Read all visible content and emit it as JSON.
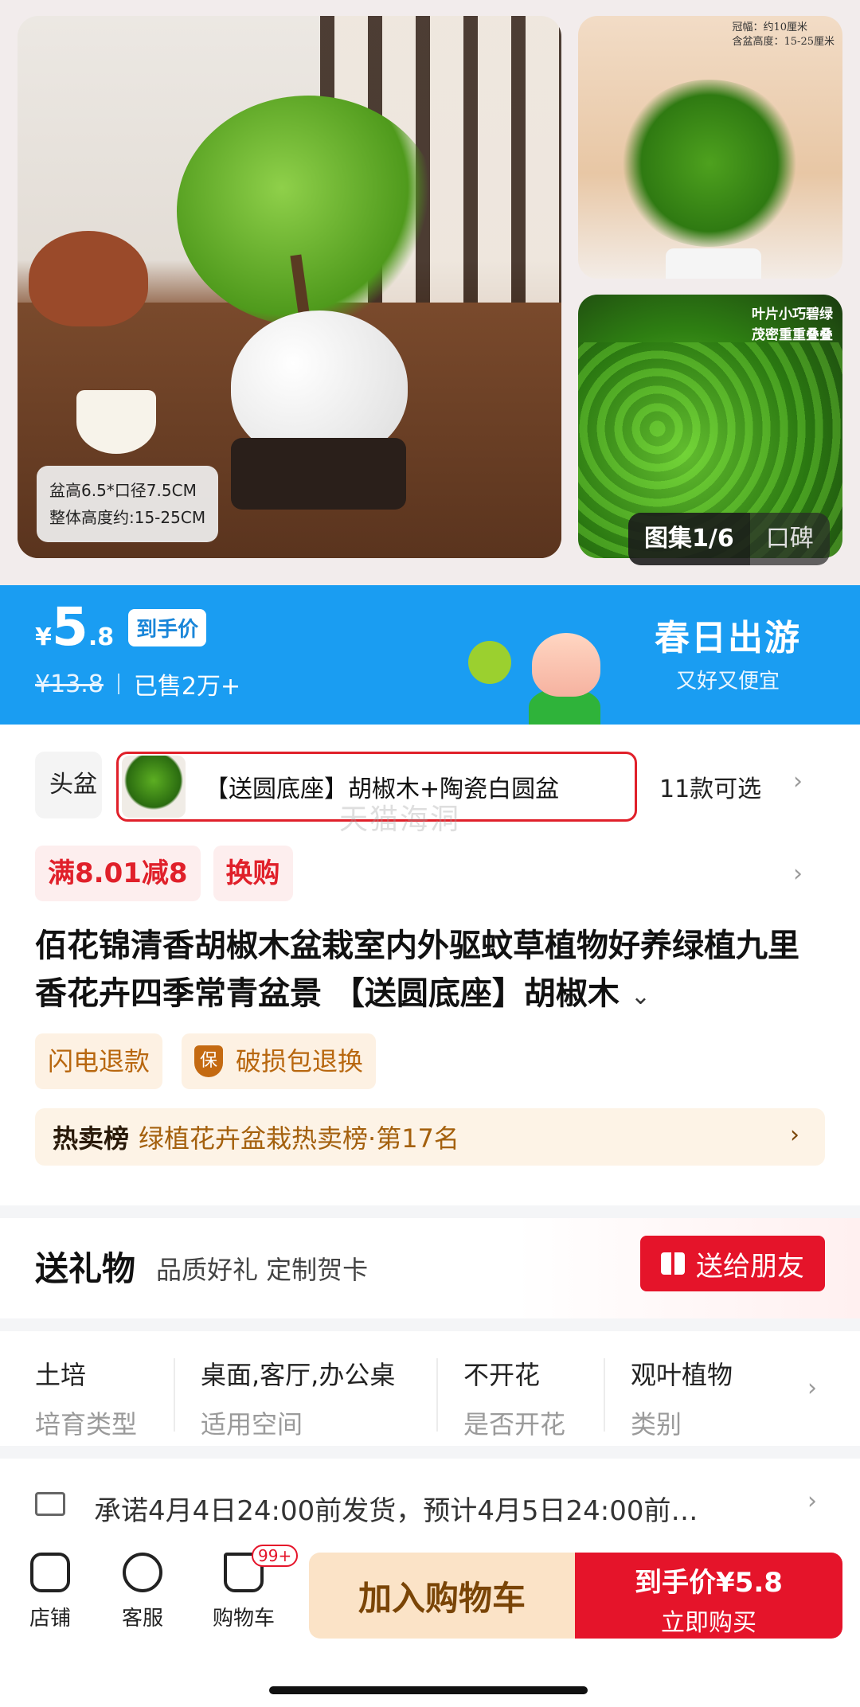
{
  "gallery": {
    "main_caption_line1": "盆高6.5*口径7.5CM",
    "main_caption_line2": "整体高度约:15-25CM",
    "side_top_note_line1": "冠幅：约10厘米",
    "side_top_note_line2": "含盆高度：15-25厘米",
    "side_bottom_note_line1": "叶片小巧碧绿",
    "side_bottom_note_line2": "茂密重重叠叠",
    "tab_gallery": "图集1/6",
    "tab_reviews": "口碑"
  },
  "price": {
    "currency": "¥",
    "integer": "5",
    "decimal": ".8",
    "tag": "到手价",
    "original": "¥13.8",
    "sold": "已售2万+",
    "promo_title": "春日出游",
    "promo_subtitle": "又好又便宜"
  },
  "sku": {
    "prev_label": "头盆",
    "current_label": "【送圆底座】胡椒木+陶瓷白圆盆",
    "count": "11款可选"
  },
  "watermark": "天猫海洞",
  "coupons": [
    "满8.01减8",
    "换购"
  ],
  "title": {
    "text": "佰花锦清香胡椒木盆栽室内外驱蚊草植物好养绿植九里香花卉四季常青盆景 【送圆底座】胡椒木",
    "expand_icon": "⌄"
  },
  "services": {
    "flash_refund": "闪电退款",
    "shield_icon": "保",
    "damage": "破损包退换"
  },
  "hot_rank": {
    "label": "热卖榜",
    "value": "绿植花卉盆栽热卖榜·第17名"
  },
  "gift": {
    "title": "送礼物",
    "subtitle": "品质好礼 定制贺卡",
    "button": "送给朋友"
  },
  "attributes": [
    {
      "value": "土培",
      "key": "培育类型"
    },
    {
      "value": "桌面,客厅,办公桌",
      "key": "适用空间"
    },
    {
      "value": "不开花",
      "key": "是否开花"
    },
    {
      "value": "观叶植物",
      "key": "类别"
    }
  ],
  "shipping": {
    "text": "承诺4月4日24:00前发货，预计4月5日24:00前…"
  },
  "bottom_bar": {
    "store": "店铺",
    "service": "客服",
    "cart": "购物车",
    "cart_badge": "99+",
    "add_to_cart": "加入购物车",
    "buy_price": "到手价¥5.8",
    "buy_now": "立即购买"
  },
  "colors": {
    "brand_blue": "#1a9df2",
    "brand_red": "#e5142a",
    "coupon_red": "#e0202a",
    "service_orange": "#b8670f"
  }
}
